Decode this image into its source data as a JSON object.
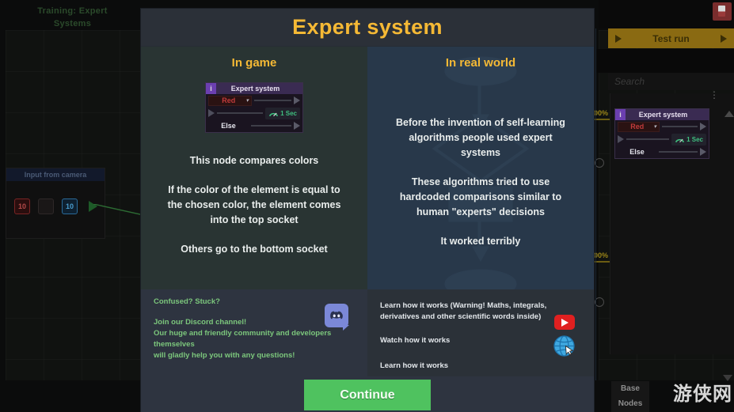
{
  "modal": {
    "title": "Expert system",
    "continue_label": "Continue",
    "panels": [
      {
        "heading": "In game",
        "paragraphs": [
          "This node compares colors",
          "If the color of the element is equal to the chosen color, the element comes into the top socket",
          "Others go to the bottom socket"
        ]
      },
      {
        "heading": "In real world",
        "paragraphs": [
          "Before the invention of self-learning algorithms people used expert systems",
          "These algorithms tried to use hardcoded comparisons similar to human \"experts\" decisions",
          "It worked terribly"
        ]
      }
    ],
    "node_widget": {
      "info_badge": "i",
      "title": "Expert system",
      "selected_color": "Red",
      "caret": "▾",
      "else_label": "Else",
      "timer_label": "1 Sec"
    },
    "footer": {
      "discord": {
        "question": "Confused? Stuck?",
        "line1": "Join our Discord channel!",
        "line2": "Our huge and friendly community and developers themselves",
        "line3": "will gladly help you with any questions!",
        "icon": "discord-icon"
      },
      "links": {
        "warning_line1": "Learn how it works (Warning! Maths, integrals,",
        "warning_line2": "derivatives and other scientific words inside)",
        "watch_label": "Watch how it works",
        "learn_label": "Learn how it works",
        "youtube_icon": "youtube-icon",
        "web_icon": "globe-icon"
      }
    }
  },
  "background": {
    "training_title": "Training: Expert\nSystems",
    "input_card": {
      "header": "Input from camera",
      "chip_red": "10",
      "chip_blue": "10"
    },
    "test_run_label": "Test run",
    "search_placeholder": "Search",
    "palette_node": {
      "info_badge": "i",
      "title": "Expert system",
      "selected_color": "Red",
      "caret": "▾",
      "else_label": "Else",
      "timer_label": "1 Sec"
    },
    "base_nodes_label": "Base\nNodes",
    "watermark": "游侠网",
    "percent_top": "00%",
    "percent_bottom": "00%"
  },
  "colors": {
    "accent_yellow": "#f5b935",
    "continue_green": "#4fc25f",
    "discord_blurple": "#7b88d8",
    "youtube_red": "#e02020",
    "panel_left_bg": "#293433",
    "panel_right_bg": "#28384a",
    "modal_bg": "#2e3440"
  }
}
